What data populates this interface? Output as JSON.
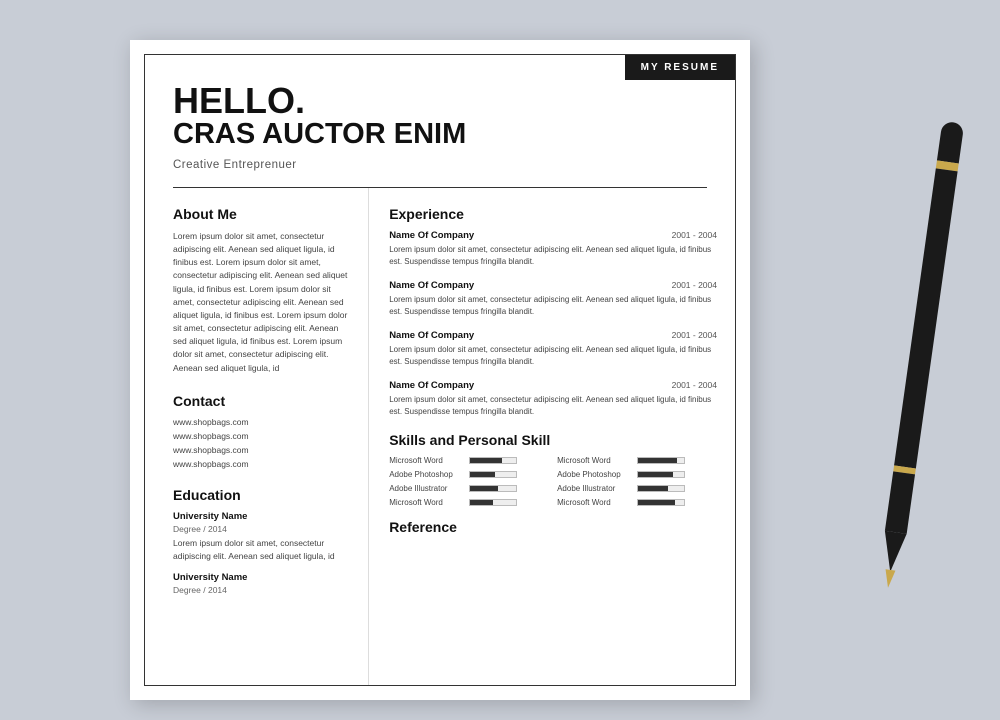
{
  "badge": "MY RESUME",
  "header": {
    "hello": "HELLO.",
    "name": "CRAS AUCTOR ENIM",
    "title": "Creative Entreprenuer"
  },
  "about": {
    "heading": "About Me",
    "text": "Lorem ipsum dolor sit amet, consectetur adipiscing elit. Aenean sed aliquet ligula, id finibus est. Lorem ipsum dolor sit amet, consectetur adipiscing elit. Aenean sed aliquet ligula, id finibus est. Lorem ipsum dolor sit amet, consectetur adipiscing elit. Aenean sed aliquet ligula, id finibus est. Lorem ipsum dolor sit amet, consectetur adipiscing elit. Aenean sed aliquet ligula, id finibus est. Lorem ipsum dolor sit amet, consectetur adipiscing elit. Aenean sed aliquet ligula, id"
  },
  "contact": {
    "heading": "Contact",
    "items": [
      "www.shopbags.com",
      "www.shopbags.com",
      "www.shopbags.com",
      "www.shopbags.com"
    ]
  },
  "education": {
    "heading": "Education",
    "entries": [
      {
        "school": "University Name",
        "degree": "Degree / 2014",
        "desc": "Lorem ipsum dolor sit amet, consectetur adipiscing elit. Aenean sed aliquet ligula, id"
      },
      {
        "school": "University Name",
        "degree": "Degree / 2014",
        "desc": ""
      }
    ]
  },
  "experience": {
    "heading": "Experience",
    "entries": [
      {
        "company": "Name Of Company",
        "dates": "2001 - 2004",
        "desc": "Lorem ipsum dolor sit amet, consectetur adipiscing elit. Aenean sed aliquet ligula, id finibus est. Suspendisse tempus fringilla blandit."
      },
      {
        "company": "Name Of Company",
        "dates": "2001 - 2004",
        "desc": "Lorem ipsum dolor sit amet, consectetur adipiscing elit. Aenean sed aliquet ligula, id finibus est. Suspendisse tempus fringilla blandit."
      },
      {
        "company": "Name Of Company",
        "dates": "2001 - 2004",
        "desc": "Lorem ipsum dolor sit amet, consectetur adipiscing elit. Aenean sed aliquet ligula, id finibus est. Suspendisse tempus fringilla blandit."
      },
      {
        "company": "Name Of Company",
        "dates": "2001 - 2004",
        "desc": "Lorem ipsum dolor sit amet, consectetur adipiscing elit. Aenean sed aliquet ligula, id finibus est. Suspendisse tempus fringilla blandit."
      }
    ]
  },
  "skills": {
    "heading": "Skills and Personal Skill",
    "entries": [
      {
        "label": "Microsoft  Word",
        "pct": 70
      },
      {
        "label": "Microsoft  Word",
        "pct": 85
      },
      {
        "label": "Adobe Photoshop",
        "pct": 55
      },
      {
        "label": "Adobe Photoshop",
        "pct": 75
      },
      {
        "label": "Adobe Illustrator",
        "pct": 60
      },
      {
        "label": "Adobe Illustrator",
        "pct": 65
      },
      {
        "label": "Microsoft  Word",
        "pct": 50
      },
      {
        "label": "Microsoft  Word",
        "pct": 80
      }
    ]
  },
  "reference": {
    "heading": "Reference"
  }
}
